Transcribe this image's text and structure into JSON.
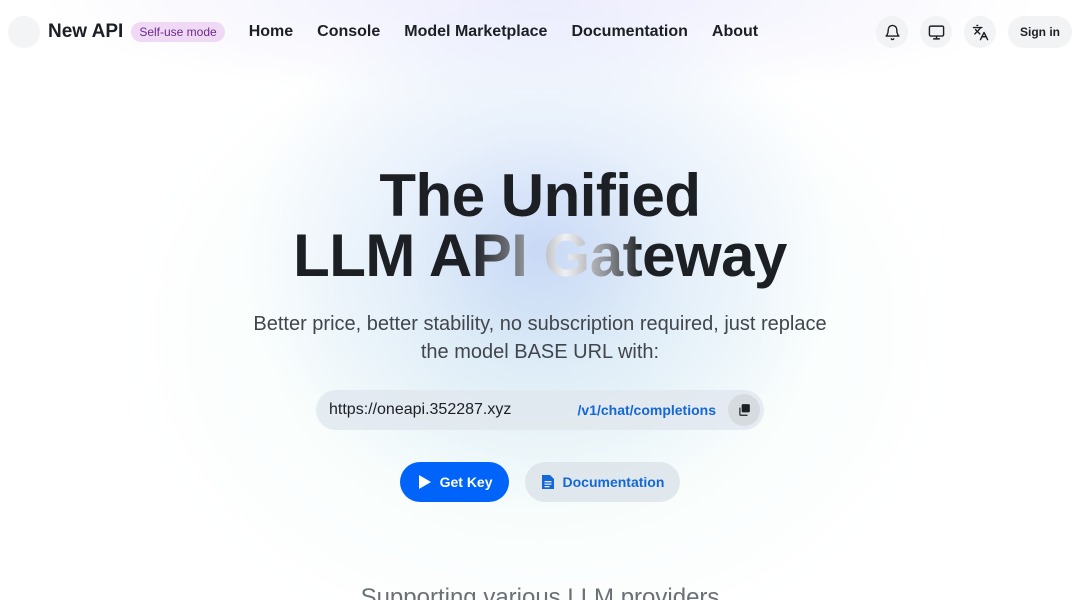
{
  "header": {
    "brand": "New API",
    "badge": "Self-use mode",
    "menu": [
      "Home",
      "Console",
      "Model Marketplace",
      "Documentation",
      "About"
    ],
    "icons": [
      "bell-icon",
      "monitor-icon",
      "translate-icon"
    ],
    "sign_in": "Sign in"
  },
  "hero": {
    "title_line1": "The Unified",
    "title_line2_a": "LLM A",
    "title_line2_b": "PI Gat",
    "title_line2_c": "eway",
    "subtitle": "Better price, better stability, no subscription required, just replace the model BASE URL with:",
    "base_url": "https://oneapi.352287.xyz",
    "endpoint": "/v1/chat/completions",
    "get_key": "Get Key",
    "documentation": "Documentation"
  },
  "providers": {
    "heading": "Supporting various LLM providers"
  },
  "colors": {
    "primary": "#0064fa",
    "link": "#1467d6",
    "badge_bg": "#f0d9f5",
    "badge_text": "#6b2a8a"
  }
}
